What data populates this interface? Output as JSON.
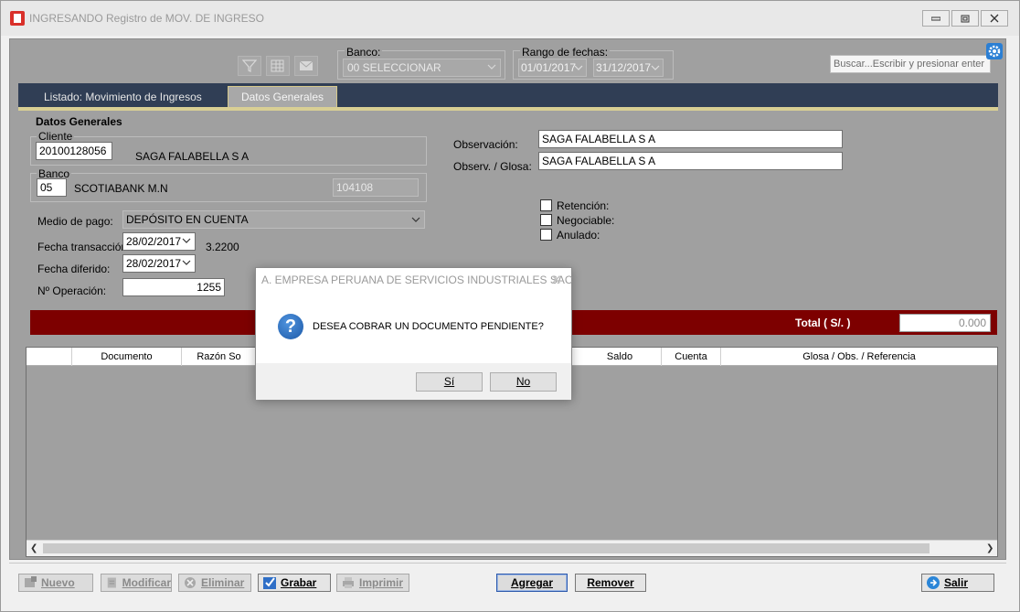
{
  "window": {
    "title": "INGRESANDO Registro de MOV. DE INGRESO"
  },
  "toolbar": {
    "banco_label": "Banco:",
    "banco_value": "00 SELECCIONAR",
    "rango_label": "Rango de fechas:",
    "fecha_desde": "01/01/2017",
    "fecha_hasta": "31/12/2017",
    "search_placeholder": "Buscar...Escribir y presionar enter"
  },
  "tabs": [
    {
      "label": "Listado: Movimiento de Ingresos"
    },
    {
      "label": "Datos Generales"
    }
  ],
  "form": {
    "section_title": "Datos Generales",
    "cliente_label": "Cliente",
    "cliente_code": "20100128056",
    "cliente_name": "SAGA FALABELLA S A",
    "banco_label": "Banco",
    "banco_code": "05",
    "banco_name": "SCOTIABANK M.N",
    "banco_account": "104108",
    "medio_pago_label": "Medio de pago:",
    "medio_pago_value": "DEPÓSITO EN CUENTA",
    "fecha_transaccion_label": "Fecha transacción:",
    "fecha_transaccion_value": "28/02/2017",
    "tipo_cambio": "3.2200",
    "fecha_diferido_label": "Fecha diferido:",
    "fecha_diferido_value": "28/02/2017",
    "operacion_label": "Nº Operación:",
    "operacion_value": "1255",
    "observacion_label": "Observación:",
    "observacion_value": "SAGA FALABELLA S A",
    "glosa_label": "Observ. / Glosa:",
    "glosa_value": "SAGA FALABELLA S A",
    "retencion_label": "Retención:",
    "negociable_label": "Negociable:",
    "anulado_label": "Anulado:"
  },
  "totals": {
    "label": "Total ( S/. )",
    "value": "0.000"
  },
  "grid": {
    "columns": [
      "Documento",
      "Razón So",
      "Saldo",
      "Cuenta",
      "Glosa / Obs. / Referencia"
    ]
  },
  "bottom_buttons": {
    "nuevo": "Nuevo",
    "modificar": "Modificar",
    "eliminar": "Eliminar",
    "grabar": "Grabar",
    "imprimir": "Imprimir",
    "agregar": "Agregar",
    "remover": "Remover",
    "salir": "Salir"
  },
  "dialog": {
    "title": "A. EMPRESA PERUANA DE SERVICIOS INDUSTRIALES SAC",
    "message": "DESEA COBRAR UN DOCUMENTO PENDIENTE?",
    "yes": "Sí",
    "no": "No"
  }
}
